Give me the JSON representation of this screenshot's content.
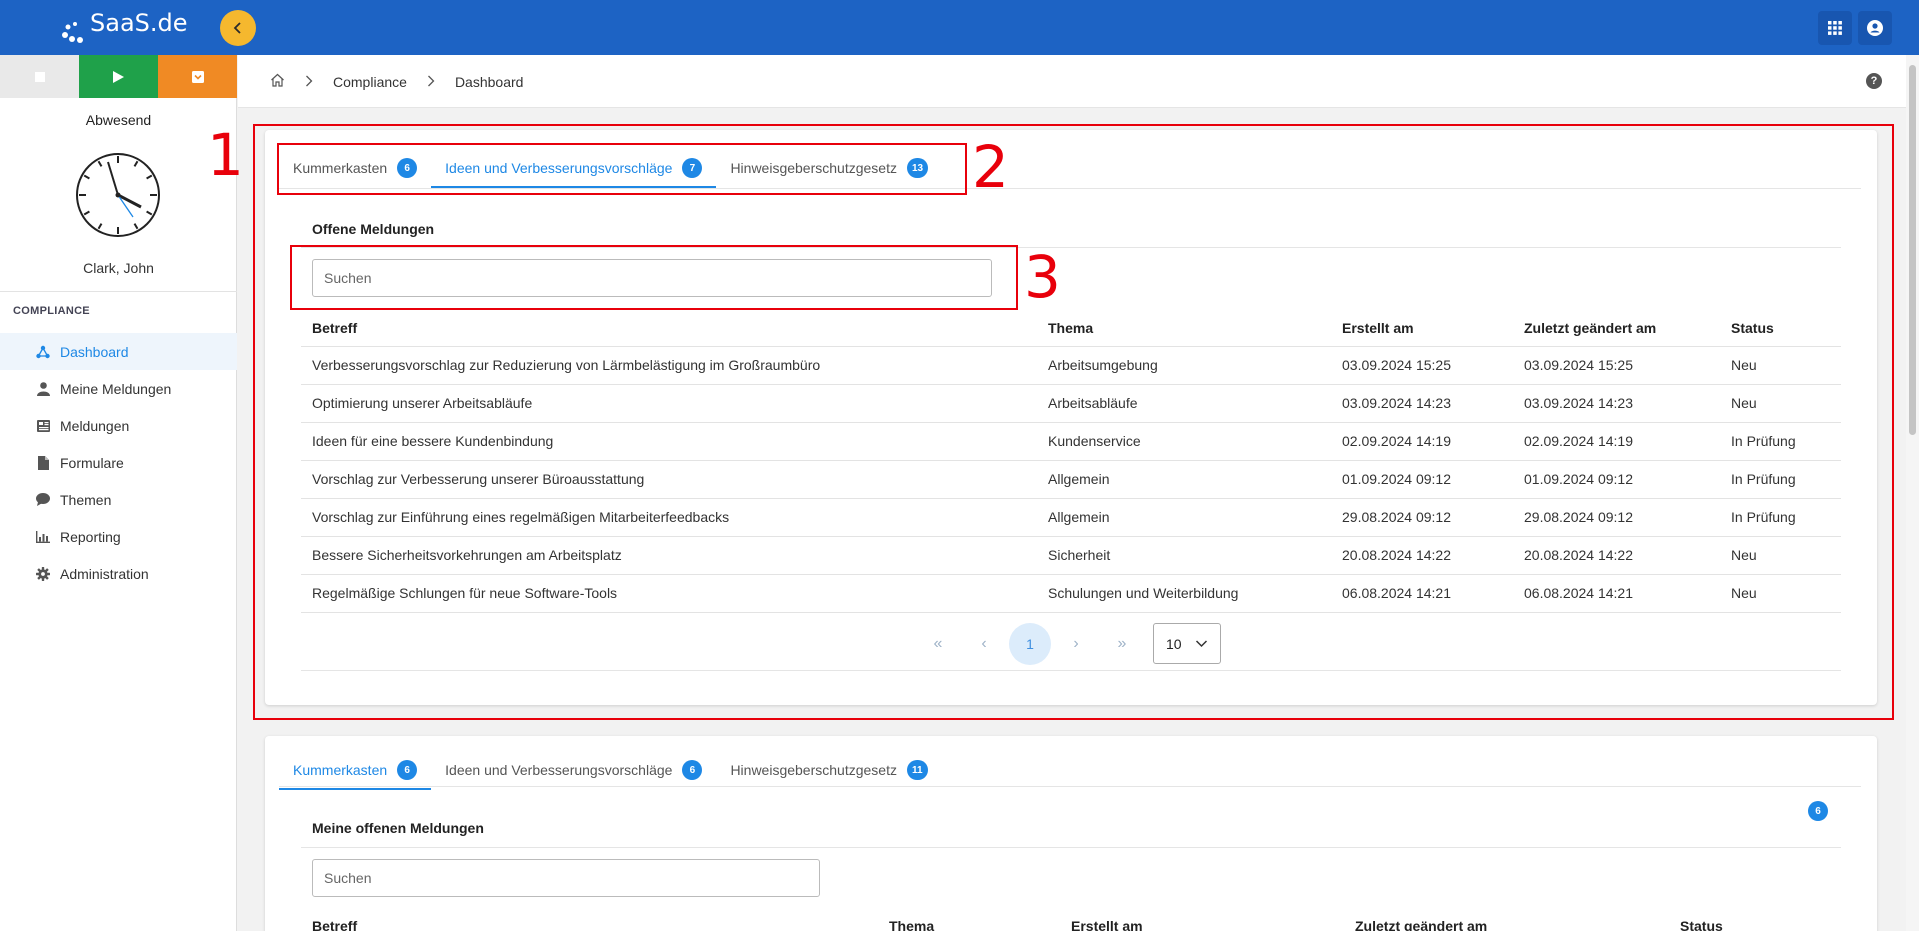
{
  "topbar": {
    "logo_text": "SaaS.de",
    "colors": {
      "bar": "#1d63c4",
      "collapse": "#f5b82e"
    },
    "icons": [
      "chevron-left-icon",
      "apps-grid-icon",
      "account-circle-icon"
    ]
  },
  "sidebar": {
    "status_buttons": [
      {
        "name": "stop",
        "icon": "stop-icon",
        "color": "#e9e9e9"
      },
      {
        "name": "play",
        "icon": "play-icon",
        "color": "#1fa14a"
      },
      {
        "name": "pause",
        "icon": "dropdown-icon",
        "color": "#f08a24"
      }
    ],
    "presence": "Abwesend",
    "user_name": "Clark, John",
    "section_title": "COMPLIANCE",
    "items": [
      {
        "label": "Dashboard",
        "icon": "dashboard-icon",
        "active": true
      },
      {
        "label": "Meine Meldungen",
        "icon": "person-icon"
      },
      {
        "label": "Meldungen",
        "icon": "newspaper-icon"
      },
      {
        "label": "Formulare",
        "icon": "file-icon"
      },
      {
        "label": "Themen",
        "icon": "chat-bubble-icon"
      },
      {
        "label": "Reporting",
        "icon": "bar-chart-icon"
      },
      {
        "label": "Administration",
        "icon": "gear-icon"
      }
    ]
  },
  "breadcrumb": {
    "items": [
      "Compliance",
      "Dashboard"
    ]
  },
  "help": {
    "label": "?"
  },
  "card1": {
    "tabs": [
      {
        "label": "Kummerkasten",
        "count": "6"
      },
      {
        "label": "Ideen und Verbesserungsvorschläge",
        "count": "7",
        "active": true
      },
      {
        "label": "Hinweisgeberschutzgesetz",
        "count": "13"
      }
    ],
    "title": "Offene Meldungen",
    "search_placeholder": "Suchen",
    "columns": [
      "Betreff",
      "Thema",
      "Erstellt am",
      "Zuletzt geändert am",
      "Status"
    ],
    "rows": [
      [
        "Verbesserungsvorschlag zur Reduzierung von Lärmbelästigung im Großraumbüro",
        "Arbeitsumgebung",
        "03.09.2024 15:25",
        "03.09.2024 15:25",
        "Neu"
      ],
      [
        "Optimierung unserer Arbeitsabläufe",
        "Arbeitsabläufe",
        "03.09.2024 14:23",
        "03.09.2024 14:23",
        "Neu"
      ],
      [
        "Ideen für eine bessere Kundenbindung",
        "Kundenservice",
        "02.09.2024 14:19",
        "02.09.2024 14:19",
        "In Prüfung"
      ],
      [
        "Vorschlag zur Verbesserung unserer Büroausstattung",
        "Allgemein",
        "01.09.2024 09:12",
        "01.09.2024 09:12",
        "In Prüfung"
      ],
      [
        "Vorschlag zur Einführung eines regelmäßigen Mitarbeiterfeedbacks",
        "Allgemein",
        "29.08.2024 09:12",
        "29.08.2024 09:12",
        "In Prüfung"
      ],
      [
        "Bessere Sicherheitsvorkehrungen am Arbeitsplatz",
        "Sicherheit",
        "20.08.2024 14:22",
        "20.08.2024 14:22",
        "Neu"
      ],
      [
        "Regelmäßige Schlungen für neue Software-Tools",
        "Schulungen und Weiterbildung",
        "06.08.2024 14:21",
        "06.08.2024 14:21",
        "Neu"
      ]
    ],
    "pager": {
      "first": "«",
      "prev": "‹",
      "current": "1",
      "next": "›",
      "last": "»",
      "page_size": "10"
    }
  },
  "card2": {
    "tabs": [
      {
        "label": "Kummerkasten",
        "count": "6",
        "active": true
      },
      {
        "label": "Ideen und Verbesserungsvorschläge",
        "count": "6"
      },
      {
        "label": "Hinweisgeberschutzgesetz",
        "count": "11"
      }
    ],
    "title": "Meine offenen Meldungen",
    "badge": "6",
    "search_placeholder": "Suchen",
    "columns": [
      "Betreff",
      "Thema",
      "Erstellt am",
      "Zuletzt geändert am",
      "Status"
    ]
  },
  "annotations": [
    "1",
    "2",
    "3"
  ]
}
